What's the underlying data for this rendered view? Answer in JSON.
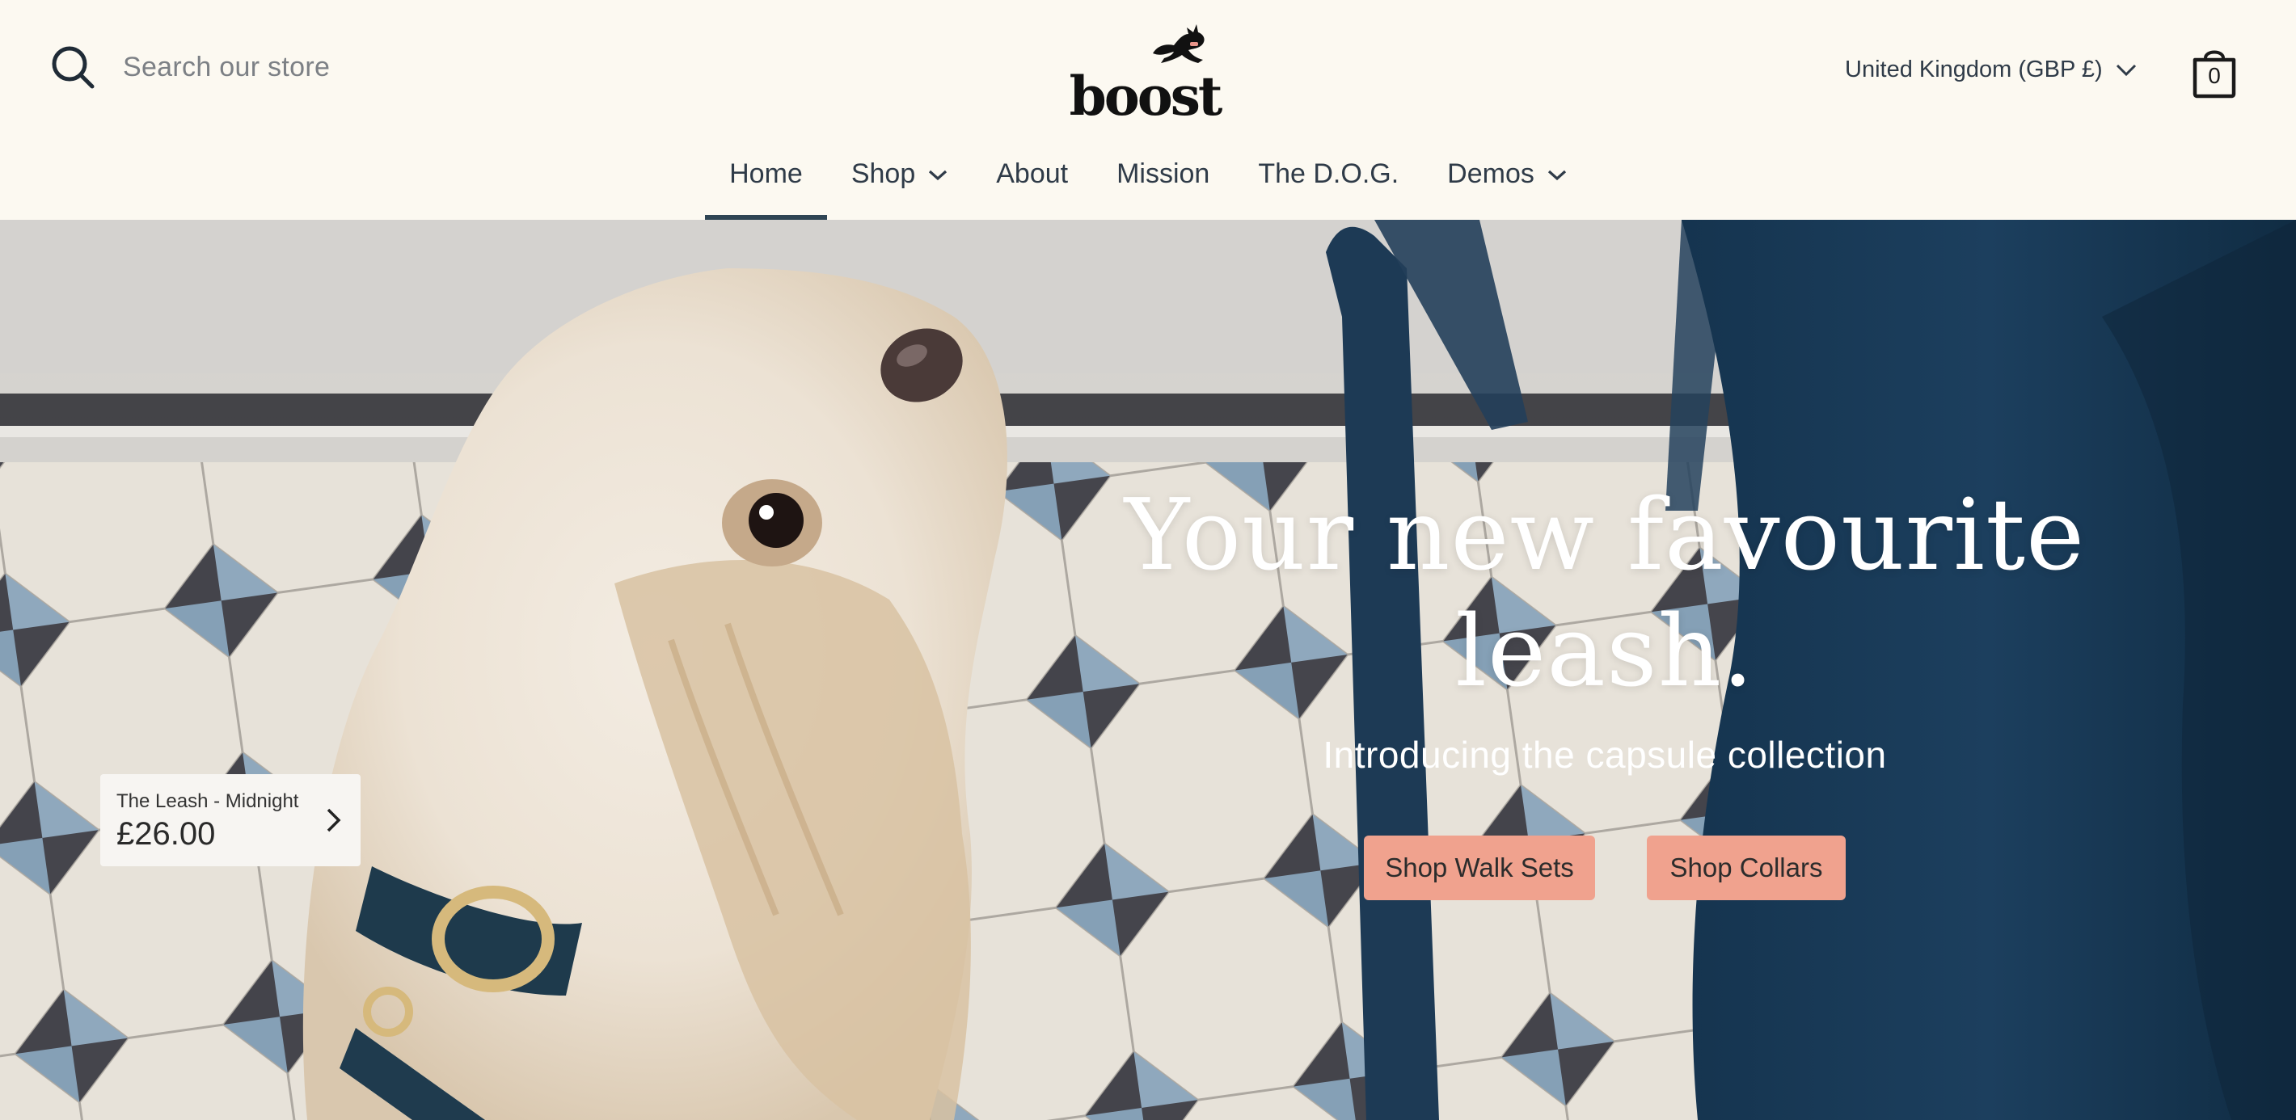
{
  "header": {
    "search_placeholder": "Search our store",
    "logo_text": "boost",
    "country_selector": "United Kingdom (GBP £)",
    "cart_count": "0"
  },
  "nav": {
    "items": [
      {
        "label": "Home",
        "active": true,
        "dropdown": false
      },
      {
        "label": "Shop",
        "active": false,
        "dropdown": true
      },
      {
        "label": "About",
        "active": false,
        "dropdown": false
      },
      {
        "label": "Mission",
        "active": false,
        "dropdown": false
      },
      {
        "label": "The D.O.G.",
        "active": false,
        "dropdown": false
      },
      {
        "label": "Demos",
        "active": false,
        "dropdown": true
      }
    ]
  },
  "hero": {
    "title_line1": "Your new favourite",
    "title_line2": "leash.",
    "subtitle": "Introducing the capsule collection",
    "buttons": [
      {
        "label": "Shop Walk Sets"
      },
      {
        "label": "Shop Collars"
      }
    ],
    "product_hotspot": {
      "name": "The Leash - Midnight",
      "price": "£26.00"
    }
  },
  "colors": {
    "background": "#fcf9f1",
    "nav_text": "#2f3b48",
    "active_underline": "#2f4554",
    "button": "#f0a28e",
    "hero_text": "#ffffff"
  },
  "icons": [
    "search-icon",
    "chevron-down-icon",
    "bag-icon",
    "chevron-right-icon",
    "dog-logo-icon"
  ]
}
